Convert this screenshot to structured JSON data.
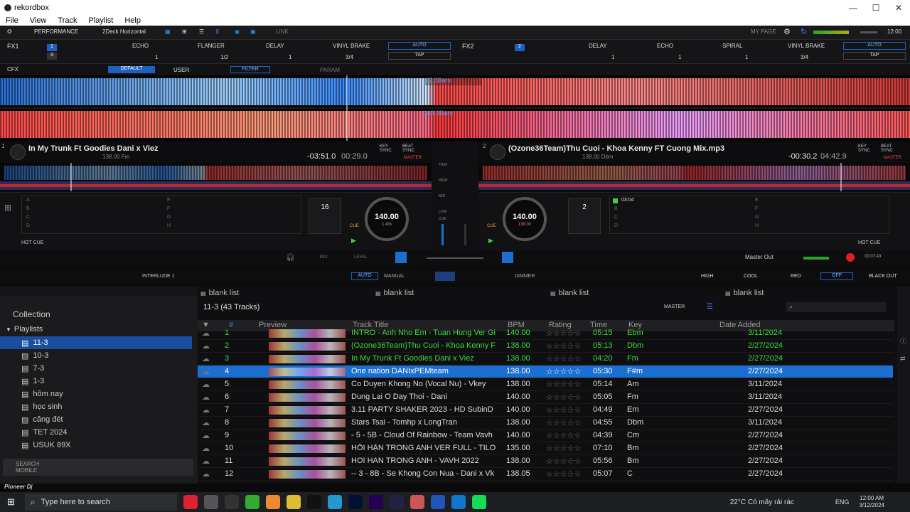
{
  "window": {
    "title": "rekordbox",
    "controls": [
      "—",
      "☐",
      "✕"
    ]
  },
  "menu": [
    "File",
    "View",
    "Track",
    "Playlist",
    "Help"
  ],
  "topbar": {
    "mode": "PERFORMANCE",
    "layout": "2Deck Horizontal",
    "link": "LINK",
    "mypage": "MY PAGE",
    "time": "12:00"
  },
  "fx": {
    "fx1": "FX1",
    "fx2": "FX2",
    "fx1_effects": [
      "ECHO",
      "FLANGER",
      "DELAY",
      "VINYL BRAKE"
    ],
    "fx2_effects": [
      "DELAY",
      "ECHO",
      "SPIRAL",
      "VINYL BRAKE"
    ],
    "fx1_vals": [
      "1",
      "1/2",
      "1",
      "3/4"
    ],
    "fx2_vals": [
      "1",
      "1",
      "1",
      "3/4"
    ],
    "auto": "AUTO",
    "tap": "TAP"
  },
  "cfx": {
    "label": "CFX",
    "default": "DEFAULT",
    "user": "USER",
    "filter": "FILTER",
    "param": "PARAM"
  },
  "waveform": {
    "label1": "17.3Bars",
    "label2": "163.3Bars"
  },
  "deck1": {
    "num": "1",
    "title": "In My Trunk Ft Goodies Dani x Viez",
    "sub": "138.00  Fm",
    "remain": "-03:51.0",
    "elapsed": "00:29.0",
    "bpm": "140.00",
    "pitch": "1.4%",
    "beat": "16",
    "hotcue": "HOT CUE",
    "sync": "KEY SYNC",
    "beatsync": "BEAT SYNC",
    "master": "MASTER"
  },
  "deck2": {
    "num": "2",
    "title": "(Ozone36Team)Thu Cuoi - Khoa Kenny FT Cuong Mix.mp3",
    "sub": "138.00  Dbm",
    "remain": "-00:30.2",
    "elapsed": "04:42.9",
    "bpm": "140.00",
    "pitch": "138.00",
    "beat": "2",
    "hotcue": "HOT CUE",
    "cuetime": "03:04",
    "sync": "KEY SYNC",
    "beatsync": "BEAT SYNC",
    "master": "MASTER"
  },
  "pads1": [
    "A",
    "B",
    "C",
    "D",
    "E",
    "F",
    "G",
    "H"
  ],
  "pads2": [
    "A",
    "B",
    "C",
    "D",
    "E",
    "F",
    "G",
    "H"
  ],
  "mixer": {
    "labels": [
      "TRIM",
      "HIGH",
      "MID",
      "LOW",
      "CUE"
    ]
  },
  "controls": {
    "mix": "MIX",
    "level": "LEVEL",
    "masterout": "Master Out",
    "clock": "00:07:43",
    "interlude": "INTERLUDE 1",
    "auto": "AUTO",
    "manual": "MANUAL",
    "dimmer": "DIMMER",
    "high": "HIGH",
    "cool": "COOL",
    "red": "RED",
    "off": "OFF",
    "blackout": "BLACK OUT"
  },
  "sidebar": {
    "collection": "Collection",
    "playlists": "Playlists",
    "items": [
      "11-3",
      "10-3",
      "7-3",
      "1-3",
      "hôm nay",
      "học sinh",
      "căng đét",
      "TET 2024",
      "USUK 89X"
    ],
    "search": "SEARCH",
    "mobile": "MOBILE"
  },
  "browser": {
    "panes": [
      "blank list",
      "blank list",
      "blank list",
      "blank list"
    ],
    "playlist": "11-3 (43 Tracks)",
    "master": "MASTER",
    "columns": [
      "#",
      "Preview",
      "Track Title",
      "BPM",
      "Rating",
      "Time",
      "Key",
      "Date Added"
    ],
    "rows": [
      {
        "n": "1",
        "title": "INTRO - Anh Nho Em - Tuan Hung Ver Gi",
        "bpm": "140.00",
        "time": "05:15",
        "key": "Ebm",
        "date": "3/11/2024",
        "played": true
      },
      {
        "n": "2",
        "title": "(Ozone36Team)Thu Cuoi - Khoa Kenny F",
        "bpm": "138.00",
        "time": "05:13",
        "key": "Dbm",
        "date": "2/27/2024",
        "played": true
      },
      {
        "n": "3",
        "title": "In My Trunk Ft Goodies Dani x Viez",
        "bpm": "138.00",
        "time": "04:20",
        "key": "Fm",
        "date": "2/27/2024",
        "played": true
      },
      {
        "n": "4",
        "title": "One nation DANIxPEMteam",
        "bpm": "138.00",
        "time": "05:30",
        "key": "F#m",
        "date": "2/27/2024",
        "selected": true
      },
      {
        "n": "5",
        "title": "Co Duyen Khong No (Vocal Nu) - Vkey",
        "bpm": "138.00",
        "time": "05:14",
        "key": "Am",
        "date": "3/11/2024"
      },
      {
        "n": "6",
        "title": "Dung Lai O Day Thoi - Dani",
        "bpm": "140.00",
        "time": "05:05",
        "key": "Fm",
        "date": "3/11/2024"
      },
      {
        "n": "7",
        "title": "3.11 PARTY SHAKER 2023 - HD SubinD",
        "bpm": "140.00",
        "time": "04:49",
        "key": "Em",
        "date": "2/27/2024"
      },
      {
        "n": "8",
        "title": "Stars Tsai - Tomhp x LongTran",
        "bpm": "138.00",
        "time": "04:55",
        "key": "Dbm",
        "date": "3/11/2024"
      },
      {
        "n": "9",
        "title": "- 5 - 5B - Cloud Of Rainbow - Team Vavh",
        "bpm": "140.00",
        "time": "04:39",
        "key": "Cm",
        "date": "2/27/2024"
      },
      {
        "n": "10",
        "title": "HỐI HẬN TRONG ANH VER FULL - TILO",
        "bpm": "135.00",
        "time": "07:10",
        "key": "Bm",
        "date": "2/27/2024"
      },
      {
        "n": "11",
        "title": "HOI HAN TRONG ANH - VAVH 2022",
        "bpm": "138.00",
        "time": "05:56",
        "key": "Bm",
        "date": "2/27/2024"
      },
      {
        "n": "12",
        "title": "-- 3 - 8B - Se Khong Con Nua - Dani x Vk",
        "bpm": "138.05",
        "time": "05:07",
        "key": "C",
        "date": "2/27/2024"
      }
    ],
    "stars": "☆☆☆☆☆"
  },
  "footer": {
    "brand": "Pioneer Dj"
  },
  "taskbar": {
    "search": "Type here to search",
    "weather": "22°C  Có mây rải rác",
    "lang": "ENG",
    "time": "12:00 AM",
    "date": "3/12/2024"
  },
  "colors": {
    "accent": "#1a6fd0",
    "played": "#3cdc3c"
  }
}
